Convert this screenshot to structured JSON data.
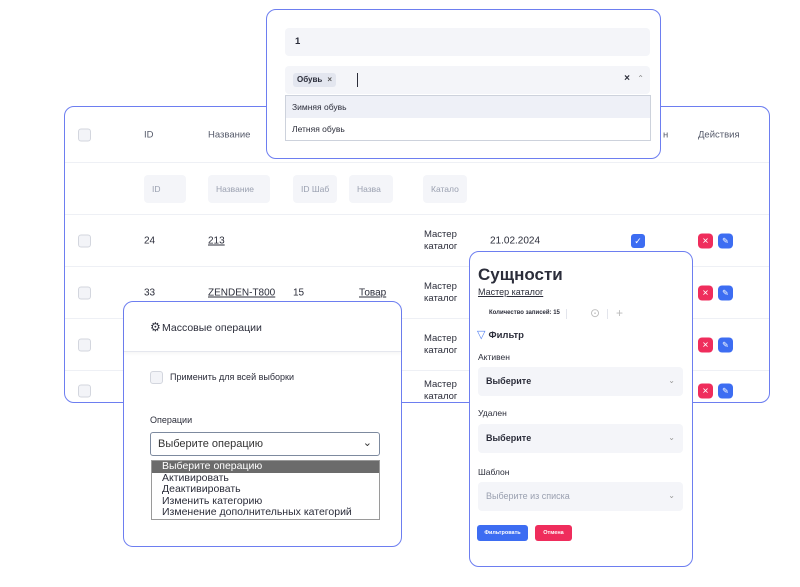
{
  "table": {
    "headers": {
      "id": "ID",
      "name": "Название",
      "active_partial": "н",
      "actions": "Действия"
    },
    "filters": {
      "id": "ID",
      "name": "Название",
      "template_id": "ID Шаб",
      "template_name": "Назва",
      "catalog": "Катало"
    },
    "rows": [
      {
        "id": "24",
        "name": "213",
        "template_id": "",
        "template_name": "",
        "catalog": "Мастер каталог",
        "date": "21.02.2024",
        "checked": true
      },
      {
        "id": "33",
        "name": "ZENDEN-T800",
        "template_id": "15",
        "template_name": "Товар",
        "catalog": "Мастер каталог",
        "date": "",
        "checked": false
      },
      {
        "id": "",
        "name": "",
        "template_id": "",
        "template_name": "",
        "catalog": "Мастер каталог",
        "date": "",
        "checked": false
      },
      {
        "id": "",
        "name": "",
        "template_id": "",
        "template_name": "",
        "catalog": "Мастер каталог",
        "date": "",
        "checked": false
      }
    ],
    "icons": {
      "delete": "close-icon",
      "edit": "pencil-icon",
      "check": "check-icon"
    }
  },
  "tag_select": {
    "input_value": "1",
    "selected_tag": "Обувь",
    "tag_remove": "×",
    "clear": "×",
    "options": [
      "Зимняя обувь",
      "Летняя обувь"
    ]
  },
  "bulk": {
    "title": "Массовые операции",
    "apply_all_label": "Применить для всей выборки",
    "operations_label": "Операции",
    "select_value": "Выберите операцию",
    "options": [
      "Выберите операцию",
      "Активировать",
      "Деактивировать",
      "Изменить категорию",
      "Изменение дополнительных категорий"
    ]
  },
  "entities": {
    "title": "Сущности",
    "subtitle": "Мастер каталог",
    "count": "Количество записей: 15",
    "filter_title": "Фильтр",
    "active_label": "Активен",
    "active_value": "Выберите",
    "deleted_label": "Удален",
    "deleted_value": "Выберите",
    "template_label": "Шаблон",
    "template_placeholder": "Выберите из списка",
    "apply_button": "Фильтровать",
    "cancel_button": "Отмена"
  },
  "colors": {
    "accent": "#3d6df2",
    "danger": "#ef2d5c",
    "border": "#6d7ef0",
    "field_bg": "#f4f5f9"
  }
}
